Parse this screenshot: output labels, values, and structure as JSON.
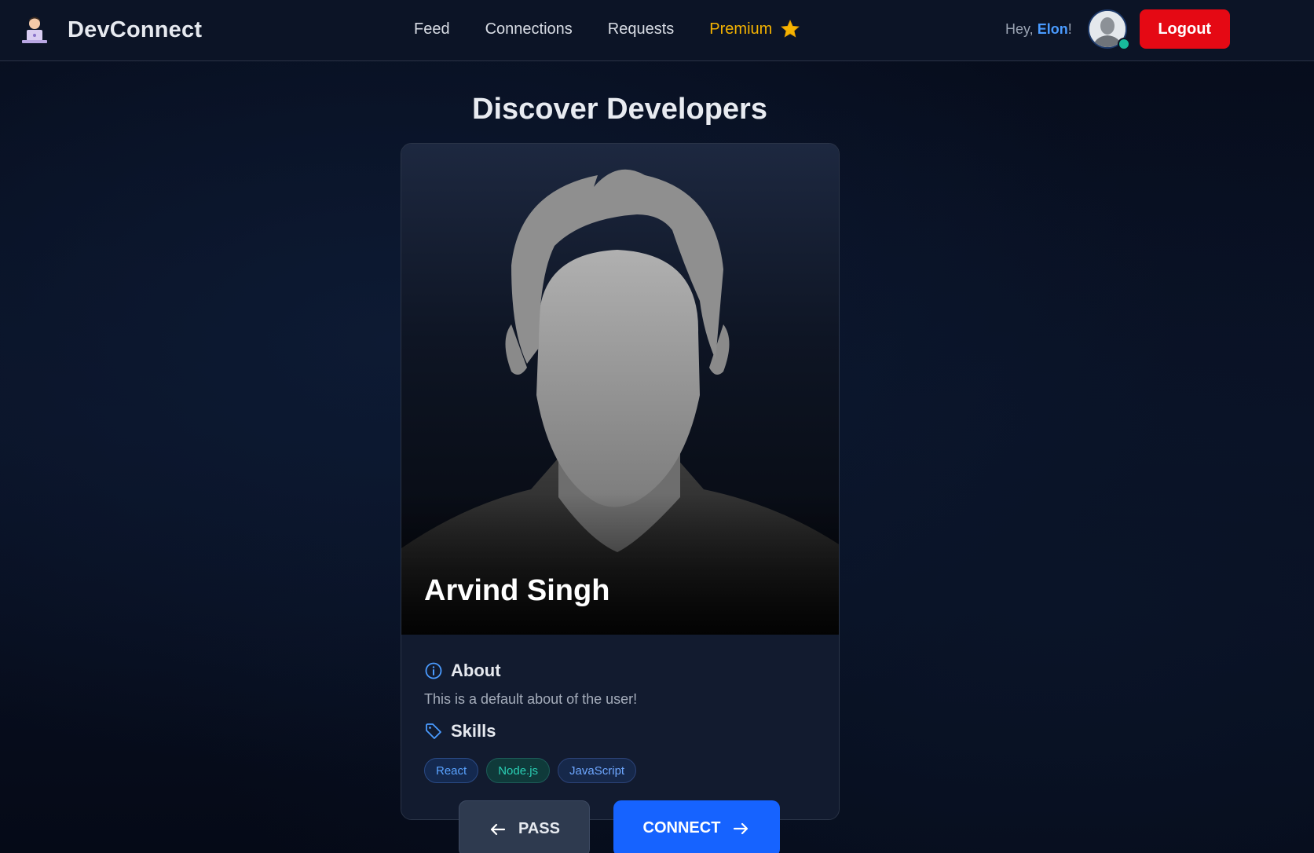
{
  "nav": {
    "brand": "DevConnect",
    "logo_icon": "developer-laptop-icon",
    "links": [
      "Feed",
      "Connections",
      "Requests"
    ],
    "premium_label": "Premium",
    "premium_icon": "star-icon",
    "greeting_prefix": "Hey, ",
    "user_name": "Elon",
    "greeting_suffix": "!",
    "avatar_icon": "user-avatar",
    "online_status_color": "#18b99b",
    "logout_label": "Logout"
  },
  "page": {
    "title": "Discover Developers"
  },
  "profile": {
    "name": "Arvind Singh",
    "photo_icon": "default-user-silhouette",
    "about_heading": "About",
    "about_icon": "info-icon",
    "about_text": "This is a default about of the user!",
    "skills_heading": "Skills",
    "skills_icon": "tag-icon",
    "skills": [
      "React",
      "Node.js",
      "JavaScript"
    ]
  },
  "actions": {
    "pass_label": "PASS",
    "connect_label": "CONNECT"
  },
  "colors": {
    "accent": "#1663ff",
    "logout": "#e50914",
    "premium": "#f5b301"
  }
}
